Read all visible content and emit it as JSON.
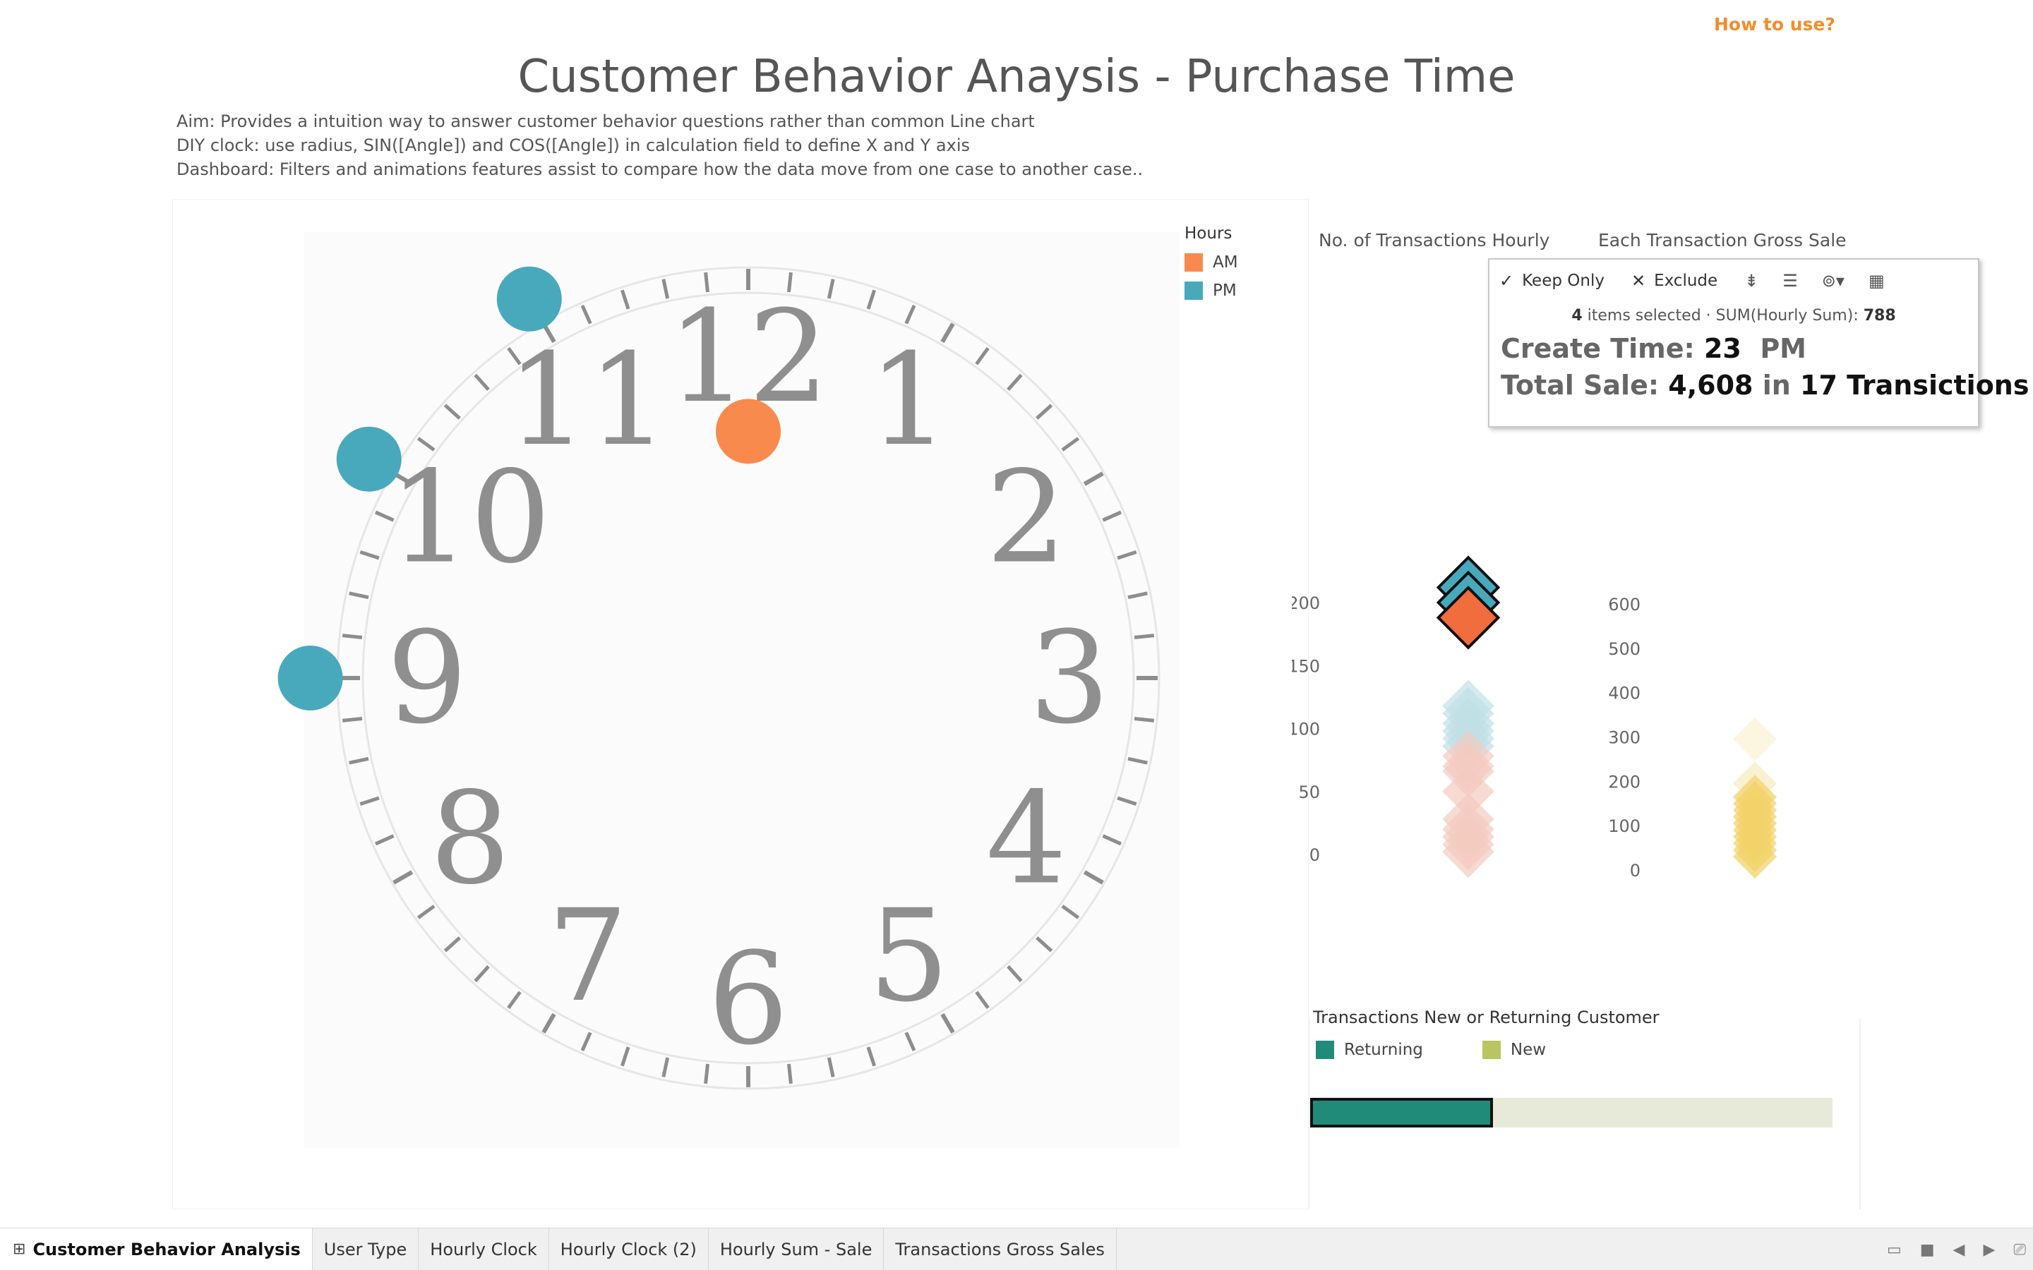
{
  "header": {
    "help_link": "How to use?",
    "title": "Customer Behavior Anaysis - Purchase Time",
    "description": [
      "Aim: Provides a intuition way to answer customer behavior questions rather than common Line chart",
      "DIY clock: use radius, SIN([Angle]) and COS([Angle]) in calculation field to define X and Y axis",
      "Dashboard: Filters and animations features assist to compare how the data move from one case to another case.."
    ]
  },
  "clock": {
    "numerals": [
      "12",
      "1",
      "2",
      "3",
      "4",
      "5",
      "6",
      "7",
      "8",
      "9",
      "10",
      "11"
    ],
    "points": [
      {
        "hour": 12,
        "radius": 0.62,
        "group": "AM"
      },
      {
        "hour": 11,
        "radius": 1.1,
        "group": "PM"
      },
      {
        "hour": 10,
        "radius": 1.1,
        "group": "PM"
      },
      {
        "hour": 9,
        "radius": 1.1,
        "group": "PM"
      }
    ]
  },
  "legend_hours": {
    "title": "Hours",
    "items": [
      {
        "label": "AM",
        "color": "#f88a4d"
      },
      {
        "label": "PM",
        "color": "#48a9bc"
      }
    ]
  },
  "transactions_chart": {
    "title": "No. of Transactions Hourly",
    "ticks": [
      "200",
      "150",
      "100",
      "50",
      "0"
    ]
  },
  "gross_sale_chart": {
    "title": "Each Transaction Gross Sale",
    "ticks": [
      "600",
      "500",
      "400",
      "300",
      "200",
      "100",
      "0"
    ]
  },
  "chart_data": [
    {
      "type": "scatter",
      "title": "No. of Transactions Hourly",
      "ylim": [
        0,
        200
      ],
      "y": [
        200,
        212,
        188,
        118,
        112,
        104,
        98,
        92,
        86,
        78,
        70,
        66,
        50,
        28,
        20,
        14,
        8,
        2
      ],
      "highlighted": [
        212,
        200,
        188
      ]
    },
    {
      "type": "scatter",
      "title": "Each Transaction Gross Sale",
      "ylim": [
        0,
        600
      ],
      "y": [
        295,
        195,
        165,
        150,
        135,
        120,
        105,
        90,
        75,
        60,
        45,
        30
      ]
    }
  ],
  "tooltip": {
    "keep_only": "Keep Only",
    "exclude": "Exclude",
    "summary_count": "4",
    "summary_text": "items selected  ·  SUM(Hourly Sum):",
    "summary_value": "788",
    "create_label": "Create Time:",
    "create_hour": "23",
    "create_period": "PM",
    "sale_label": "Total Sale:",
    "sale_value": "4,608",
    "sale_in": "in",
    "sale_count": "17 Transictions"
  },
  "new_returning": {
    "title": "Transactions New or Returning Customer",
    "legend": [
      {
        "label": "Returning",
        "color": "#218b79"
      },
      {
        "label": "New",
        "color": "#b9c560"
      }
    ],
    "returning_fraction": 0.35
  },
  "tabs": [
    "Customer Behavior Analysis",
    "User Type",
    "Hourly Clock",
    "Hourly Clock (2)",
    "Hourly Sum - Sale",
    "Transactions Gross Sales"
  ]
}
